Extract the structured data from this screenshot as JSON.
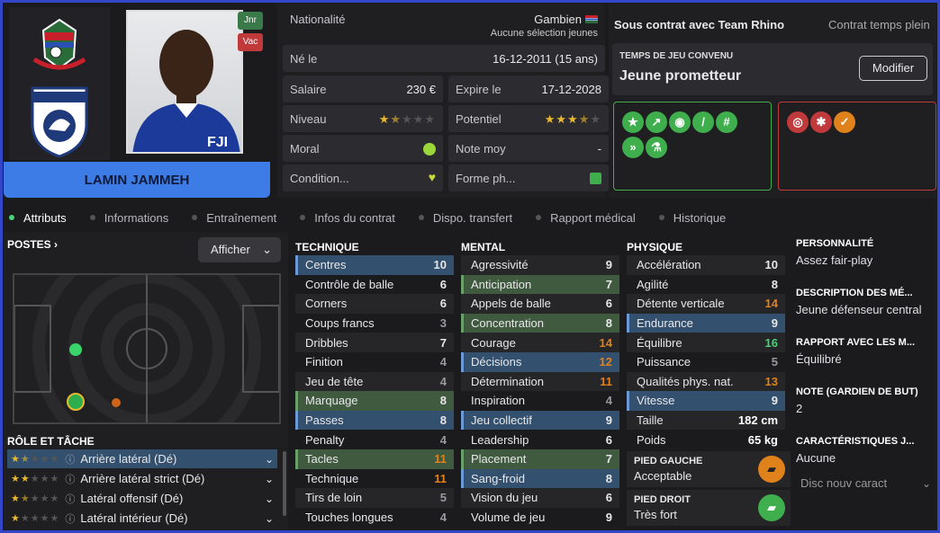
{
  "player": {
    "name": "LAMIN JAMMEH",
    "tag_jnr": "Jnr",
    "tag_vac": "Vac"
  },
  "info": {
    "nationality_label": "Nationalité",
    "nationality": "Gambien",
    "nationality_sub": "Aucune sélection jeunes",
    "born_label": "Né le",
    "born": "16-12-2011 (15 ans)",
    "salary_label": "Salaire",
    "salary": "230 €",
    "expiry_label": "Expire le",
    "expiry": "17-12-2028",
    "level_label": "Niveau",
    "level_stars": 1.5,
    "potential_label": "Potentiel",
    "potential_stars": 3.5,
    "moral_label": "Moral",
    "avg_label": "Note moy",
    "avg": "-",
    "condition_label": "Condition...",
    "form_label": "Forme ph..."
  },
  "contract": {
    "title": "Sous contrat avec Team Rhino",
    "type": "Contrat temps plein",
    "playing_time_label": "TEMPS DE JEU CONVENU",
    "playing_time": "Jeune prometteur",
    "modify": "Modifier"
  },
  "tabs": [
    "Attributs",
    "Informations",
    "Entraînement",
    "Infos du contrat",
    "Dispo. transfert",
    "Rapport médical",
    "Historique"
  ],
  "positions": {
    "title": "POSTES",
    "show": "Afficher"
  },
  "roles": {
    "title": "RÔLE ET TÂCHE",
    "items": [
      {
        "label": "Arrière latéral (Dé)",
        "stars": 1.5
      },
      {
        "label": "Arrière latéral strict (Dé)",
        "stars": 2
      },
      {
        "label": "Latéral offensif (Dé)",
        "stars": 1.5
      },
      {
        "label": "Latéral intérieur (Dé)",
        "stars": 1
      }
    ]
  },
  "technique": {
    "title": "TECHNIQUE",
    "rows": [
      {
        "n": "Centres",
        "v": "10",
        "hl": "b"
      },
      {
        "n": "Contrôle de balle",
        "v": "6"
      },
      {
        "n": "Corners",
        "v": "6"
      },
      {
        "n": "Coups francs",
        "v": "3"
      },
      {
        "n": "Dribbles",
        "v": "7"
      },
      {
        "n": "Finition",
        "v": "4"
      },
      {
        "n": "Jeu de tête",
        "v": "4"
      },
      {
        "n": "Marquage",
        "v": "8",
        "hl": "g"
      },
      {
        "n": "Passes",
        "v": "8",
        "hl": "b"
      },
      {
        "n": "Penalty",
        "v": "4"
      },
      {
        "n": "Tacles",
        "v": "11",
        "hl": "g"
      },
      {
        "n": "Technique",
        "v": "11"
      },
      {
        "n": "Tirs de loin",
        "v": "5"
      },
      {
        "n": "Touches longues",
        "v": "4"
      }
    ]
  },
  "mental": {
    "title": "MENTAL",
    "rows": [
      {
        "n": "Agressivité",
        "v": "9"
      },
      {
        "n": "Anticipation",
        "v": "7",
        "hl": "g"
      },
      {
        "n": "Appels de balle",
        "v": "6"
      },
      {
        "n": "Concentration",
        "v": "8",
        "hl": "g"
      },
      {
        "n": "Courage",
        "v": "14"
      },
      {
        "n": "Décisions",
        "v": "12",
        "hl": "b"
      },
      {
        "n": "Détermination",
        "v": "11"
      },
      {
        "n": "Inspiration",
        "v": "4"
      },
      {
        "n": "Jeu collectif",
        "v": "9",
        "hl": "b"
      },
      {
        "n": "Leadership",
        "v": "6"
      },
      {
        "n": "Placement",
        "v": "7",
        "hl": "g"
      },
      {
        "n": "Sang-froid",
        "v": "8",
        "hl": "b"
      },
      {
        "n": "Vision du jeu",
        "v": "6"
      },
      {
        "n": "Volume de jeu",
        "v": "9"
      }
    ]
  },
  "physique": {
    "title": "PHYSIQUE",
    "rows": [
      {
        "n": "Accélération",
        "v": "10"
      },
      {
        "n": "Agilité",
        "v": "8"
      },
      {
        "n": "Détente verticale",
        "v": "14"
      },
      {
        "n": "Endurance",
        "v": "9",
        "hl": "b"
      },
      {
        "n": "Équilibre",
        "v": "16"
      },
      {
        "n": "Puissance",
        "v": "5"
      },
      {
        "n": "Qualités phys. nat.",
        "v": "13"
      },
      {
        "n": "Vitesse",
        "v": "9",
        "hl": "b"
      },
      {
        "n": "Taille",
        "v": "182 cm"
      },
      {
        "n": "Poids",
        "v": "65 kg"
      }
    ],
    "left_foot_label": "PIED GAUCHE",
    "left_foot": "Acceptable",
    "right_foot_label": "PIED DROIT",
    "right_foot": "Très fort"
  },
  "side": {
    "personality_label": "PERSONNALITÉ",
    "personality": "Assez fair-play",
    "desc_label": "DESCRIPTION DES MÉ...",
    "desc": "Jeune défenseur central",
    "relation_label": "RAPPORT AVEC LES M...",
    "relation": "Équilibré",
    "gk_label": "NOTE (GARDIEN DE BUT)",
    "gk": "2",
    "traits_label": "CARACTÉRISTIQUES J...",
    "traits": "Aucune",
    "new_trait": "Disc nouv caract"
  },
  "colors": {
    "accent": "#3d7ce6",
    "good": "#4ad17a",
    "bad": "#d43030",
    "orange": "#e0821c"
  }
}
